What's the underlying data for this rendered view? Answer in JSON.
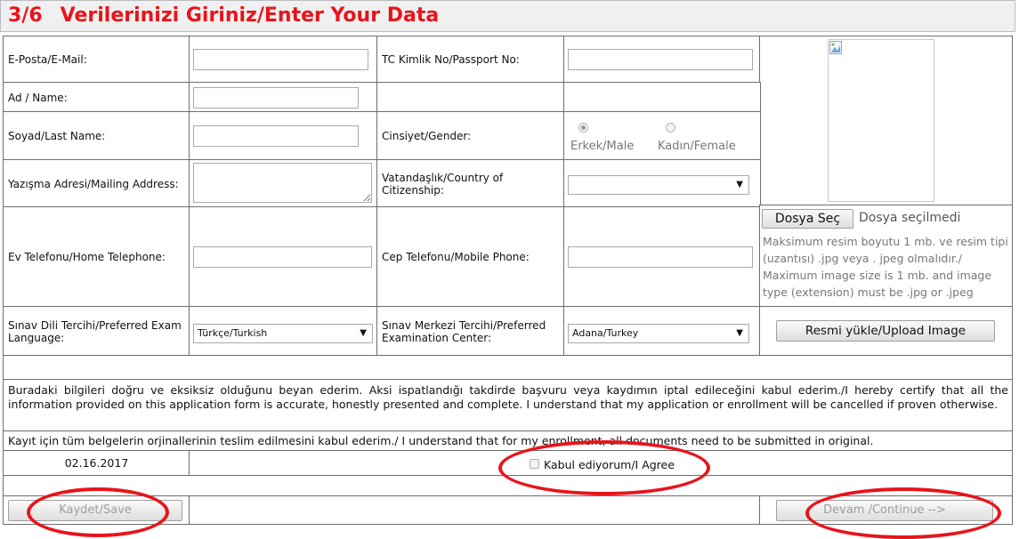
{
  "header": {
    "step": "3/6",
    "title": "Verilerinizi Giriniz/Enter Your Data"
  },
  "form": {
    "email_label": "E-Posta/E-Mail:",
    "tc_label": "TC Kimlik No/Passport No:",
    "name_label": "Ad / Name:",
    "surname_label": "Soyad/Last Name:",
    "gender_label": "Cinsiyet/Gender:",
    "gender_male": "Erkek/Male",
    "gender_female": "Kadın/Female",
    "address_label": "Yazışma Adresi/Mailing Address:",
    "citizenship_label": "Vatandaşlık/Country of Citizenship:",
    "citizenship_value": "",
    "home_phone_label": "Ev Telefonu/Home Telephone:",
    "mobile_label": "Cep Telefonu/Mobile Phone:",
    "exam_lang_label": "Sınav Dili Tercihi/Preferred Exam Language:",
    "exam_lang_value": "Türkçe/Turkish",
    "exam_center_label": "Sınav Merkezi Tercihi/Preferred Examination Center:",
    "exam_center_value": "Adana/Turkey"
  },
  "photo": {
    "choose_file": "Dosya Seç",
    "no_file": "Dosya seçilmedi",
    "note": "Maksimum resim boyutu 1 mb. ve resim tipi (uzantısı) .jpg veya . jpeg olmalıdır./ Maximum image size is 1 mb. and image type (extension) must be .jpg or .jpeg",
    "upload_button": "Resmi yükle/Upload Image"
  },
  "declaration": {
    "statement": "Buradaki bilgileri doğru ve eksiksiz olduğunu beyan ederim. Aksi ispatlandığı takdirde başvuru veya kaydımın iptal edileceğini kabul ederim./I hereby certify that all the information provided on this application form is accurate, honestly presented and complete. I understand that my application or enrollment will be cancelled if proven otherwise.",
    "originals": "Kayıt için tüm belgelerin orjinallerinin teslim edilmesini kabul ederim./ I understand that for my enrollment, all documents need to be submitted in original.",
    "date": "02.16.2017",
    "agree_label": "Kabul ediyorum/I Agree"
  },
  "actions": {
    "save": "Kaydet/Save",
    "continue": "Devam /Continue -->"
  },
  "colors": {
    "title": "#e8141b",
    "annotation": "#e8141b"
  }
}
